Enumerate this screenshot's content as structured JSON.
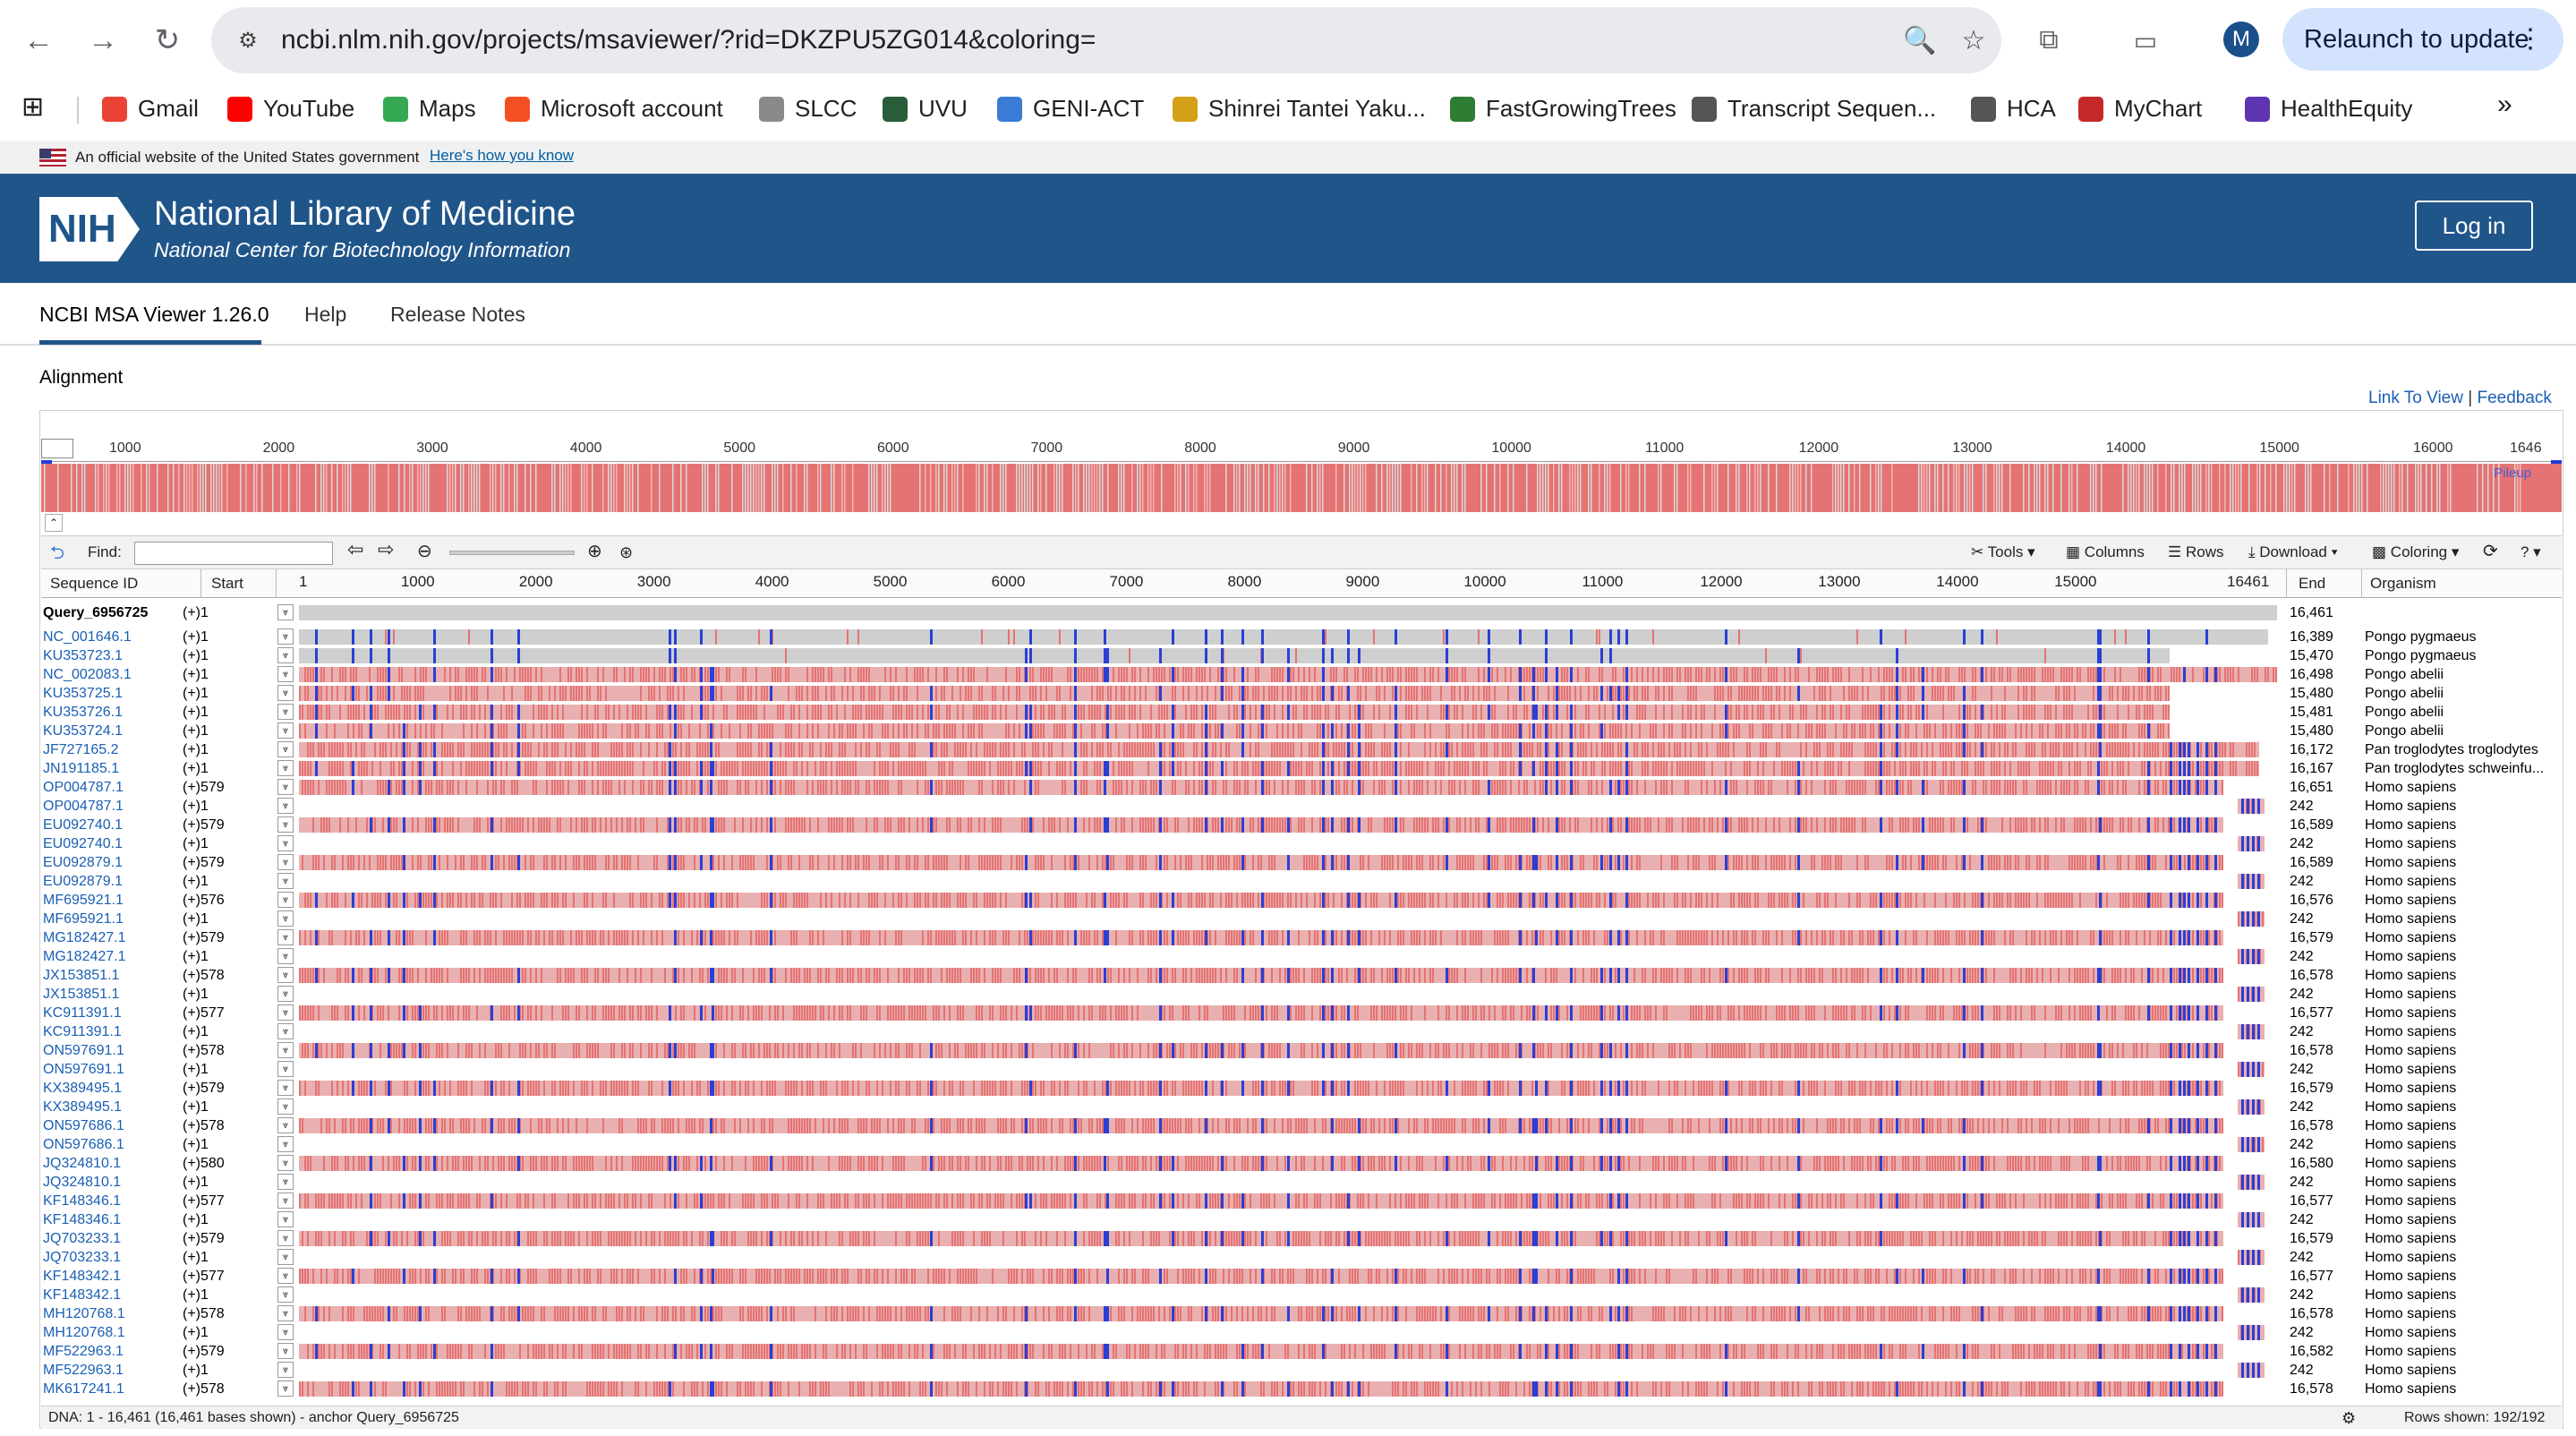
{
  "browser": {
    "url": "ncbi.nlm.nih.gov/projects/msaviewer/?rid=DKZPU5ZG014&coloring=",
    "relaunch_label": "Relaunch to update",
    "profile_initial": "M"
  },
  "bookmarks": [
    {
      "label": "Gmail",
      "color": "#ea4335"
    },
    {
      "label": "YouTube",
      "color": "#ff0000"
    },
    {
      "label": "Maps",
      "color": "#34a853"
    },
    {
      "label": "Microsoft account",
      "color": "#f25022"
    },
    {
      "label": "SLCC",
      "color": "#8a8a8a"
    },
    {
      "label": "UVU",
      "color": "#275d38"
    },
    {
      "label": "GENI-ACT",
      "color": "#3a7bd5"
    },
    {
      "label": "Shinrei Tantei Yaku...",
      "color": "#d4a017"
    },
    {
      "label": "FastGrowingTrees",
      "color": "#2e7d32"
    },
    {
      "label": "Transcript Sequen...",
      "color": "#555555"
    },
    {
      "label": "HCA",
      "color": "#555555"
    },
    {
      "label": "MyChart",
      "color": "#c62828"
    },
    {
      "label": "HealthEquity",
      "color": "#5e35b1"
    }
  ],
  "gov_banner": {
    "text": "An official website of the United States government",
    "link": "Here's how you know"
  },
  "header": {
    "logo": "NIH",
    "title": "National Library of Medicine",
    "subtitle": "National Center for Biotechnology Information",
    "login": "Log in"
  },
  "nav_tabs": [
    "NCBI MSA Viewer 1.26.0",
    "Help",
    "Release Notes"
  ],
  "section_title": "Alignment",
  "top_links": {
    "link_to_view": "Link To View",
    "separator": "|",
    "feedback": "Feedback"
  },
  "overview": {
    "ticks": [
      "1000",
      "2000",
      "3000",
      "4000",
      "5000",
      "6000",
      "7000",
      "8000",
      "9000",
      "10000",
      "11000",
      "12000",
      "13000",
      "14000",
      "15000",
      "16000",
      "1646"
    ],
    "pileup_label": "Pileup"
  },
  "toolbar": {
    "find_label": "Find:",
    "tools": "Tools",
    "columns": "Columns",
    "rows": "Rows",
    "download": "Download",
    "coloring": "Coloring"
  },
  "table_header": {
    "seq_id": "Sequence ID",
    "start": "Start",
    "end": "End",
    "organism": "Organism",
    "ticks": [
      "1",
      "1000",
      "2000",
      "3000",
      "4000",
      "5000",
      "6000",
      "7000",
      "8000",
      "9000",
      "10000",
      "11000",
      "12000",
      "13000",
      "14000",
      "15000",
      "16461"
    ]
  },
  "rows": [
    {
      "id": "Query_6956725",
      "start": "(+)1",
      "end": "16,461",
      "org": "",
      "kind": "query"
    },
    {
      "id": "NC_001646.1",
      "start": "(+)1",
      "end": "16,389",
      "org": "Pongo pygmaeus",
      "kind": "ape1"
    },
    {
      "id": "KU353723.1",
      "start": "(+)1",
      "end": "15,470",
      "org": "Pongo pygmaeus",
      "kind": "ape2"
    },
    {
      "id": "NC_002083.1",
      "start": "(+)1",
      "end": "16,498",
      "org": "Pongo abelii",
      "kind": "abelii"
    },
    {
      "id": "KU353725.1",
      "start": "(+)1",
      "end": "15,480",
      "org": "Pongo abelii",
      "kind": "abelii2"
    },
    {
      "id": "KU353726.1",
      "start": "(+)1",
      "end": "15,481",
      "org": "Pongo abelii",
      "kind": "abelii2"
    },
    {
      "id": "KU353724.1",
      "start": "(+)1",
      "end": "15,480",
      "org": "Pongo abelii",
      "kind": "abelii2"
    },
    {
      "id": "JF727165.2",
      "start": "(+)1",
      "end": "16,172",
      "org": "Pan troglodytes troglodytes",
      "kind": "pan"
    },
    {
      "id": "JN191185.1",
      "start": "(+)1",
      "end": "16,167",
      "org": "Pan troglodytes schweinfu...",
      "kind": "pan"
    },
    {
      "id": "OP004787.1",
      "start": "(+)579",
      "end": "16,651",
      "org": "Homo sapiens",
      "kind": "hsl"
    },
    {
      "id": "OP004787.1",
      "start": "(+)1",
      "end": "242",
      "org": "Homo sapiens",
      "kind": "hss"
    },
    {
      "id": "EU092740.1",
      "start": "(+)579",
      "end": "16,589",
      "org": "Homo sapiens",
      "kind": "hsl"
    },
    {
      "id": "EU092740.1",
      "start": "(+)1",
      "end": "242",
      "org": "Homo sapiens",
      "kind": "hss"
    },
    {
      "id": "EU092879.1",
      "start": "(+)579",
      "end": "16,589",
      "org": "Homo sapiens",
      "kind": "hsl"
    },
    {
      "id": "EU092879.1",
      "start": "(+)1",
      "end": "242",
      "org": "Homo sapiens",
      "kind": "hss"
    },
    {
      "id": "MF695921.1",
      "start": "(+)576",
      "end": "16,576",
      "org": "Homo sapiens",
      "kind": "hsl"
    },
    {
      "id": "MF695921.1",
      "start": "(+)1",
      "end": "242",
      "org": "Homo sapiens",
      "kind": "hss"
    },
    {
      "id": "MG182427.1",
      "start": "(+)579",
      "end": "16,579",
      "org": "Homo sapiens",
      "kind": "hsl"
    },
    {
      "id": "MG182427.1",
      "start": "(+)1",
      "end": "242",
      "org": "Homo sapiens",
      "kind": "hss"
    },
    {
      "id": "JX153851.1",
      "start": "(+)578",
      "end": "16,578",
      "org": "Homo sapiens",
      "kind": "hsl"
    },
    {
      "id": "JX153851.1",
      "start": "(+)1",
      "end": "242",
      "org": "Homo sapiens",
      "kind": "hss"
    },
    {
      "id": "KC911391.1",
      "start": "(+)577",
      "end": "16,577",
      "org": "Homo sapiens",
      "kind": "hsl"
    },
    {
      "id": "KC911391.1",
      "start": "(+)1",
      "end": "242",
      "org": "Homo sapiens",
      "kind": "hss"
    },
    {
      "id": "ON597691.1",
      "start": "(+)578",
      "end": "16,578",
      "org": "Homo sapiens",
      "kind": "hsl"
    },
    {
      "id": "ON597691.1",
      "start": "(+)1",
      "end": "242",
      "org": "Homo sapiens",
      "kind": "hss"
    },
    {
      "id": "KX389495.1",
      "start": "(+)579",
      "end": "16,579",
      "org": "Homo sapiens",
      "kind": "hsl"
    },
    {
      "id": "KX389495.1",
      "start": "(+)1",
      "end": "242",
      "org": "Homo sapiens",
      "kind": "hss"
    },
    {
      "id": "ON597686.1",
      "start": "(+)578",
      "end": "16,578",
      "org": "Homo sapiens",
      "kind": "hsl"
    },
    {
      "id": "ON597686.1",
      "start": "(+)1",
      "end": "242",
      "org": "Homo sapiens",
      "kind": "hss"
    },
    {
      "id": "JQ324810.1",
      "start": "(+)580",
      "end": "16,580",
      "org": "Homo sapiens",
      "kind": "hsl"
    },
    {
      "id": "JQ324810.1",
      "start": "(+)1",
      "end": "242",
      "org": "Homo sapiens",
      "kind": "hss"
    },
    {
      "id": "KF148346.1",
      "start": "(+)577",
      "end": "16,577",
      "org": "Homo sapiens",
      "kind": "hsl"
    },
    {
      "id": "KF148346.1",
      "start": "(+)1",
      "end": "242",
      "org": "Homo sapiens",
      "kind": "hss"
    },
    {
      "id": "JQ703233.1",
      "start": "(+)579",
      "end": "16,579",
      "org": "Homo sapiens",
      "kind": "hsl"
    },
    {
      "id": "JQ703233.1",
      "start": "(+)1",
      "end": "242",
      "org": "Homo sapiens",
      "kind": "hss"
    },
    {
      "id": "KF148342.1",
      "start": "(+)577",
      "end": "16,577",
      "org": "Homo sapiens",
      "kind": "hsl"
    },
    {
      "id": "KF148342.1",
      "start": "(+)1",
      "end": "242",
      "org": "Homo sapiens",
      "kind": "hss"
    },
    {
      "id": "MH120768.1",
      "start": "(+)578",
      "end": "16,578",
      "org": "Homo sapiens",
      "kind": "hsl"
    },
    {
      "id": "MH120768.1",
      "start": "(+)1",
      "end": "242",
      "org": "Homo sapiens",
      "kind": "hss"
    },
    {
      "id": "MF522963.1",
      "start": "(+)579",
      "end": "16,582",
      "org": "Homo sapiens",
      "kind": "hsl"
    },
    {
      "id": "MF522963.1",
      "start": "(+)1",
      "end": "242",
      "org": "Homo sapiens",
      "kind": "hss"
    },
    {
      "id": "MK617241.1",
      "start": "(+)578",
      "end": "16,578",
      "org": "Homo sapiens",
      "kind": "hsl"
    }
  ],
  "status": {
    "left": "DNA: 1 - 16,461 (16,461 bases shown) - anchor Query_6956725",
    "right": "Rows shown: 192/192"
  },
  "colors": {
    "mismatch": "#e57373",
    "match": "#cfcfcf",
    "gap": "#2a3fd6",
    "nih_blue": "#20558a"
  }
}
